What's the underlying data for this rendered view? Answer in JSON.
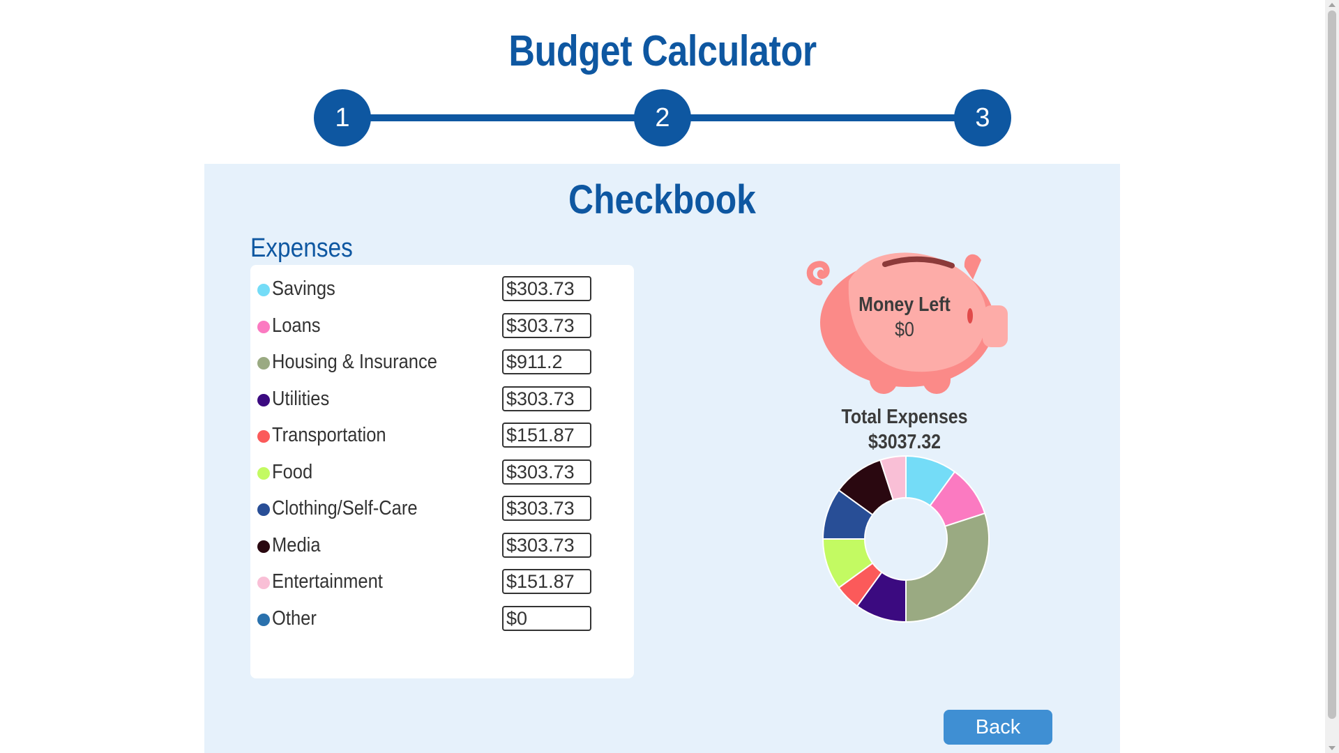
{
  "app": {
    "title": "Budget Calculator"
  },
  "stepper": {
    "steps": [
      "1",
      "2",
      "3"
    ],
    "color": "#0e57a1"
  },
  "checkbook": {
    "title": "Checkbook",
    "expenses_heading": "Expenses",
    "expenses": [
      {
        "label": "Savings",
        "value": "$303.73",
        "color": "#74dcf7"
      },
      {
        "label": "Loans",
        "value": "$303.73",
        "color": "#fb7ac1"
      },
      {
        "label": "Housing & Insurance",
        "value": "$911.2",
        "color": "#9aaa82"
      },
      {
        "label": "Utilities",
        "value": "$303.73",
        "color": "#3b0a80"
      },
      {
        "label": "Transportation",
        "value": "$151.87",
        "color": "#fb5a5a"
      },
      {
        "label": "Food",
        "value": "$303.73",
        "color": "#c3fa62"
      },
      {
        "label": "Clothing/Self-Care",
        "value": "$303.73",
        "color": "#284e96"
      },
      {
        "label": "Media",
        "value": "$303.73",
        "color": "#2a0810"
      },
      {
        "label": "Entertainment",
        "value": "$151.87",
        "color": "#f9bfd6"
      },
      {
        "label": "Other",
        "value": "$0",
        "color": "#2a71ad"
      }
    ],
    "money_left_label": "Money Left",
    "money_left_value": "$0",
    "total_label": "Total Expenses",
    "total_value": "$3037.32",
    "back_label": "Back"
  },
  "chart_data": {
    "type": "pie",
    "donut": true,
    "categories": [
      "Savings",
      "Loans",
      "Housing & Insurance",
      "Utilities",
      "Transportation",
      "Food",
      "Clothing/Self-Care",
      "Media",
      "Entertainment",
      "Other"
    ],
    "values": [
      303.73,
      303.73,
      911.2,
      303.73,
      151.87,
      303.73,
      303.73,
      303.73,
      151.87,
      0
    ],
    "colors": [
      "#74dcf7",
      "#fb7ac1",
      "#9aaa82",
      "#3b0a80",
      "#fb5a5a",
      "#c3fa62",
      "#284e96",
      "#2a0810",
      "#f9bfd6",
      "#2a71ad"
    ]
  },
  "colors": {
    "brand": "#0e57a1",
    "panel_bg": "#e6f1fb",
    "button": "#3f8fd3",
    "piggy_body": "#fb8a88",
    "piggy_highlight": "#fdaca8"
  }
}
